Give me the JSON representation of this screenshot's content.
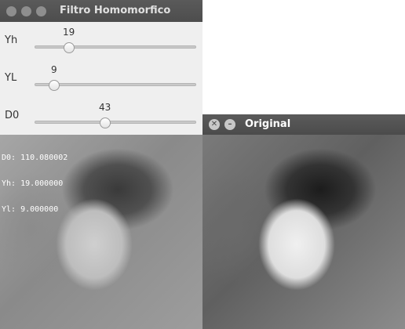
{
  "filter_window": {
    "title": "Filtro Homomorfico",
    "sliders": [
      {
        "label": "Yh",
        "value": "19",
        "fraction": 0.2
      },
      {
        "label": "YL",
        "value": "9",
        "fraction": 0.1
      },
      {
        "label": "D0",
        "value": "43",
        "fraction": 0.43
      }
    ],
    "overlay": {
      "d0": "D0: 110.080002",
      "yh": "Yh: 19.000000",
      "yl": "Yl: 9.000000"
    }
  },
  "original_window": {
    "title": "Original"
  }
}
